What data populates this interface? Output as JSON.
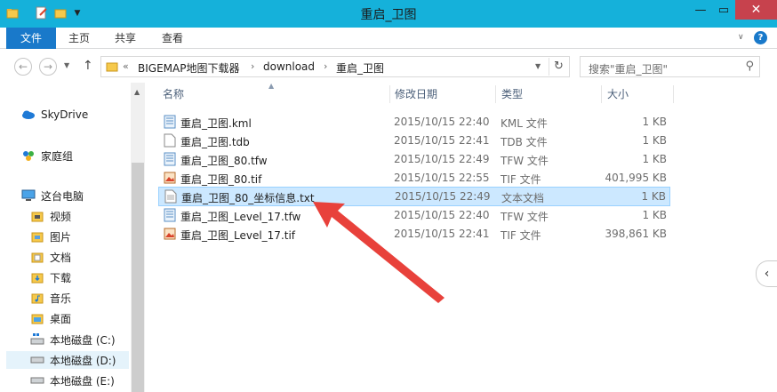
{
  "window": {
    "title": "重启_卫图"
  },
  "ribbon": {
    "tabs": [
      "文件",
      "主页",
      "共享",
      "查看"
    ]
  },
  "address": {
    "prefix": "«",
    "crumbs": [
      "BIGEMAP地图下载器",
      "download",
      "重启_卫图"
    ],
    "search_placeholder": "搜索\"重启_卫图\""
  },
  "columns": {
    "name": "名称",
    "date": "修改日期",
    "type": "类型",
    "size": "大小"
  },
  "nav": {
    "items": [
      {
        "label": "SkyDrive",
        "icon": "cloud-icon"
      },
      {
        "label": "家庭组",
        "icon": "homegroup-icon"
      },
      {
        "label": "这台电脑",
        "icon": "computer-icon"
      },
      {
        "label": "视频",
        "icon": "video-folder-icon"
      },
      {
        "label": "图片",
        "icon": "pictures-folder-icon"
      },
      {
        "label": "文档",
        "icon": "documents-folder-icon"
      },
      {
        "label": "下载",
        "icon": "downloads-folder-icon"
      },
      {
        "label": "音乐",
        "icon": "music-folder-icon"
      },
      {
        "label": "桌面",
        "icon": "desktop-folder-icon"
      },
      {
        "label": "本地磁盘 (C:)",
        "icon": "system-drive-icon"
      },
      {
        "label": "本地磁盘 (D:)",
        "icon": "drive-icon"
      },
      {
        "label": "本地磁盘 (E:)",
        "icon": "drive-icon"
      }
    ]
  },
  "files": [
    {
      "name": "重启_卫图.kml",
      "date": "2015/10/15 22:40",
      "type": "KML 文件",
      "size": "1 KB",
      "icon": "kml-file-icon"
    },
    {
      "name": "重启_卫图.tdb",
      "date": "2015/10/15 22:41",
      "type": "TDB 文件",
      "size": "1 KB",
      "icon": "blank-file-icon"
    },
    {
      "name": "重启_卫图_80.tfw",
      "date": "2015/10/15 22:49",
      "type": "TFW 文件",
      "size": "1 KB",
      "icon": "text-file-icon"
    },
    {
      "name": "重启_卫图_80.tif",
      "date": "2015/10/15 22:55",
      "type": "TIF 文件",
      "size": "401,995 KB",
      "icon": "image-file-icon"
    },
    {
      "name": "重启_卫图_80_坐标信息.txt",
      "date": "2015/10/15 22:49",
      "type": "文本文档",
      "size": "1 KB",
      "icon": "txt-file-icon"
    },
    {
      "name": "重启_卫图_Level_17.tfw",
      "date": "2015/10/15 22:40",
      "type": "TFW 文件",
      "size": "1 KB",
      "icon": "text-file-icon"
    },
    {
      "name": "重启_卫图_Level_17.tif",
      "date": "2015/10/15 22:41",
      "type": "TIF 文件",
      "size": "398,861 KB",
      "icon": "image-file-icon"
    }
  ],
  "colors": {
    "titlebar": "#15b1da",
    "file_tab": "#1979ca",
    "selection": "#cce8ff",
    "arrow": "#e8413b"
  }
}
